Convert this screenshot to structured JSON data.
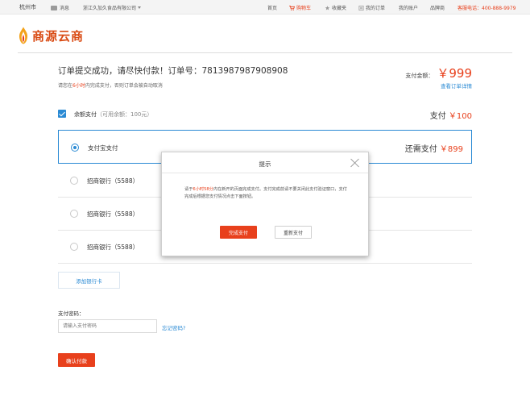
{
  "topbar": {
    "city": "杭州市",
    "message": "消息",
    "company": "浙江久加久食品有限公司",
    "nav": {
      "home": "首页",
      "cart": "购物车",
      "favorites": "收藏夹",
      "my_orders": "我的订单",
      "my_account": "我的账户",
      "brands": "品牌商",
      "service": "客服电话：400-888-9979"
    }
  },
  "logo": {
    "text": "商源云商"
  },
  "order": {
    "title": "订单提交成功，请尽快付款！订单号：7813987987908908",
    "notice_prefix": "请您在",
    "notice_time": "6小时",
    "notice_suffix": "内完成支付，否则订单会被自动取消",
    "amount_label": "支付金额：",
    "amount_value": "￥999",
    "detail_link": "查看订单详情"
  },
  "balance": {
    "label": "余额支付",
    "available": "（可用余额：100元）",
    "pay_label": "支付",
    "pay_value": "￥100"
  },
  "payment_options": [
    {
      "name": "支付宝支付",
      "selected": true,
      "right_label": "还需支付",
      "right_value": "￥899"
    },
    {
      "name": "招商银行（5588）",
      "selected": false
    },
    {
      "name": "招商银行（5588）",
      "selected": false
    },
    {
      "name": "招商银行（5588）",
      "selected": false
    }
  ],
  "add_card": "添加银行卡",
  "password": {
    "label": "支付密码：",
    "placeholder": "请输入支付密码",
    "forgot": "忘记密码?"
  },
  "confirm_button": "确认付款",
  "modal": {
    "title": "提示",
    "body_prefix": "请于",
    "body_time": "6小时58分",
    "body_suffix": "内在新开的页面完成支付。支付完成前请不要关闭此支付验证窗口，支付完成后根据您支付情况点击下面按钮。",
    "done_button": "完成支付",
    "retry_button": "重新支付"
  },
  "colors": {
    "accent": "#e8401c",
    "link": "#2a8ad4"
  }
}
